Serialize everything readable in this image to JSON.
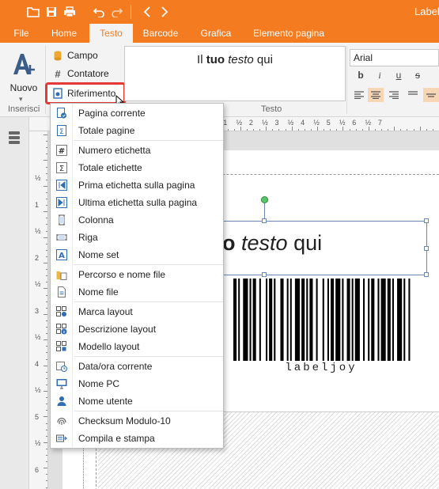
{
  "app": {
    "title": "Labelj"
  },
  "tabs": [
    {
      "label": "File",
      "active": false
    },
    {
      "label": "Home",
      "active": false
    },
    {
      "label": "Testo",
      "active": true
    },
    {
      "label": "Barcode",
      "active": false
    },
    {
      "label": "Grafica",
      "active": false
    },
    {
      "label": "Elemento pagina",
      "active": false
    }
  ],
  "ribbon": {
    "new_label": "Nuovo",
    "insert_group_label": "Inserisci",
    "text_group_label": "Testo",
    "campo_label": "Campo",
    "contatore_label": "Contatore",
    "riferimento_label": "Riferimento",
    "preview": {
      "pre": "Il ",
      "bold": "tuo",
      "mid": " ",
      "italic": "testo",
      "post": " qui"
    },
    "font_name": "Arial",
    "format_buttons": [
      "b",
      "i",
      "u",
      "s"
    ]
  },
  "canvas": {
    "text": {
      "bold": "o",
      "italic": "testo",
      "post": "qui"
    },
    "barcode_text": "labeljoy",
    "hruler_labels": [
      "½",
      "1",
      "½",
      "2",
      "½",
      "3",
      "½",
      "4",
      "½",
      "5",
      "½",
      "6",
      "½",
      "7"
    ],
    "vruler_labels": [
      "½",
      "1",
      "½",
      "2",
      "½",
      "3",
      "½",
      "4",
      "½",
      "5",
      "½",
      "6"
    ]
  },
  "menu": {
    "groups": [
      {
        "items": [
          {
            "label": "Pagina corrente",
            "icon": "current-page-icon"
          },
          {
            "label": "Totale pagine",
            "icon": "total-pages-icon"
          }
        ]
      },
      {
        "items": [
          {
            "label": "Numero etichetta",
            "icon": "hash-icon"
          },
          {
            "label": "Totale etichette",
            "icon": "sigma-icon"
          },
          {
            "label": "Prima etichetta sulla pagina",
            "icon": "first-label-icon"
          },
          {
            "label": "Ultima etichetta sulla pagina",
            "icon": "last-label-icon"
          },
          {
            "label": "Colonna",
            "icon": "column-icon"
          },
          {
            "label": "Riga",
            "icon": "row-icon"
          },
          {
            "label": "Nome set",
            "icon": "text-a-icon"
          }
        ]
      },
      {
        "items": [
          {
            "label": "Percorso e nome file",
            "icon": "folder-file-icon"
          },
          {
            "label": "Nome file",
            "icon": "file-icon"
          }
        ]
      },
      {
        "items": [
          {
            "label": "Marca layout",
            "icon": "layout-brand-icon"
          },
          {
            "label": "Descrizione layout",
            "icon": "layout-info-icon"
          },
          {
            "label": "Modello layout",
            "icon": "layout-model-icon"
          }
        ]
      },
      {
        "items": [
          {
            "label": "Data/ora corrente",
            "icon": "calendar-clock-icon"
          },
          {
            "label": "Nome PC",
            "icon": "computer-icon"
          },
          {
            "label": "Nome utente",
            "icon": "user-icon"
          }
        ]
      },
      {
        "items": [
          {
            "label": "Checksum Modulo-10",
            "icon": "fingerprint-icon"
          },
          {
            "label": "Compila e stampa",
            "icon": "compile-print-icon"
          }
        ]
      }
    ]
  },
  "colors": {
    "accent": "#f47b20",
    "highlight": "#e53935",
    "icon_blue": "#2f6db5"
  }
}
